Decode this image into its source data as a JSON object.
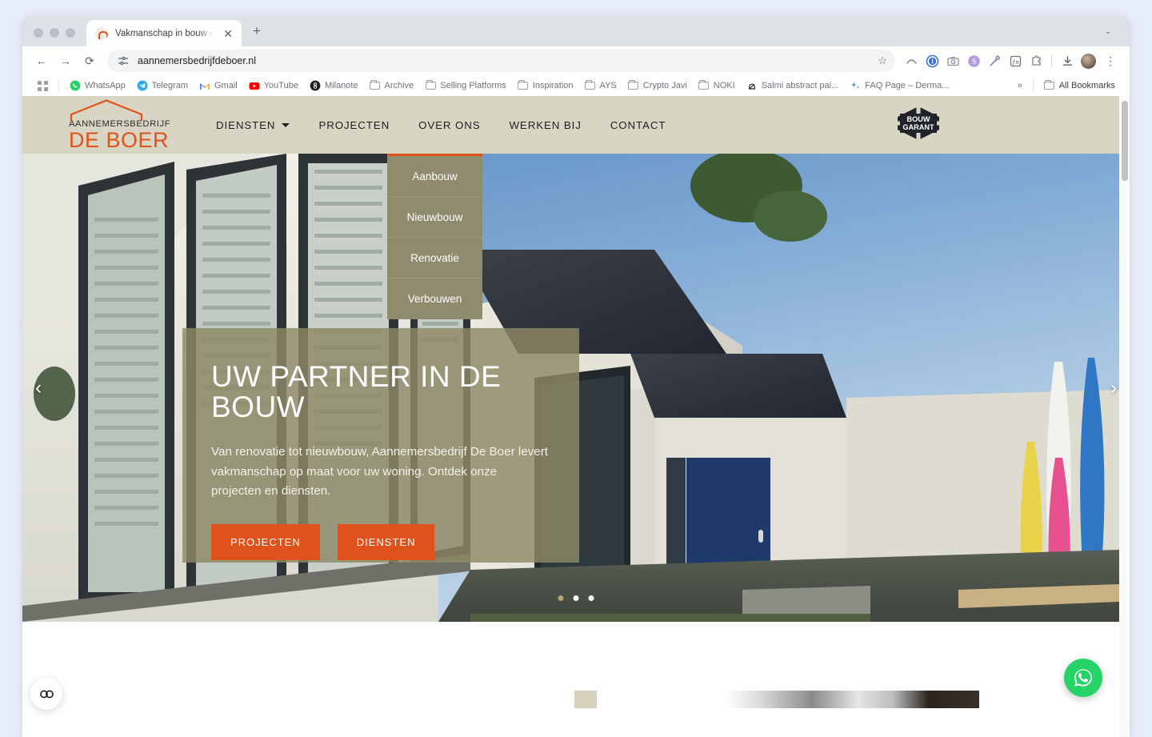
{
  "browser": {
    "tab": {
      "title": "Vakmanschap in bouw en verb",
      "close_label": "✕"
    },
    "new_tab_label": "+",
    "window_caret": "⌄",
    "nav": {
      "back": "←",
      "forward": "→",
      "reload": "⟳"
    },
    "omnibox": {
      "url": "aannemersbedrijfdeboer.nl",
      "site_info_icon": "page-settings-icon",
      "bookmark_star": "☆"
    },
    "extensions": [
      {
        "name": "arc-icon",
        "glyph": "⌃"
      },
      {
        "name": "onepassword-icon",
        "glyph": "1"
      },
      {
        "name": "screenshot-camera-icon",
        "glyph": "▣"
      },
      {
        "name": "scribe-s-icon",
        "glyph": "S"
      },
      {
        "name": "eyedropper-icon",
        "glyph": "✐"
      },
      {
        "name": "fonts-ninja-icon",
        "glyph": "ƒn"
      },
      {
        "name": "extensions-puzzle-icon",
        "glyph": "⧉"
      },
      {
        "name": "downloads-icon",
        "glyph": "⤓"
      }
    ],
    "menu_icon": "⋮",
    "bookmarks": {
      "apps_icon": "apps-grid-icon",
      "items": [
        {
          "label": "WhatsApp",
          "icon": "whatsapp-icon",
          "color": "#25D366"
        },
        {
          "label": "Telegram",
          "icon": "telegram-icon",
          "color": "#2AABEE"
        },
        {
          "label": "Gmail",
          "icon": "gmail-icon",
          "color": "#EA4335"
        },
        {
          "label": "YouTube",
          "icon": "youtube-icon",
          "color": "#FF0000"
        },
        {
          "label": "Milanote",
          "icon": "milanote-icon",
          "color": "#222222"
        },
        {
          "label": "Archive",
          "icon": "folder-icon",
          "color": ""
        },
        {
          "label": "Selling Platforms",
          "icon": "folder-icon",
          "color": ""
        },
        {
          "label": "Inspiration",
          "icon": "folder-icon",
          "color": ""
        },
        {
          "label": "AYS",
          "icon": "folder-icon",
          "color": ""
        },
        {
          "label": "Crypto Javi",
          "icon": "folder-icon",
          "color": ""
        },
        {
          "label": "NOKI",
          "icon": "folder-icon",
          "color": ""
        },
        {
          "label": "Salmi abstract pai...",
          "icon": "salmi-icon",
          "color": ""
        },
        {
          "label": "FAQ Page – Derma...",
          "icon": "sparkle-icon",
          "color": "#5B8DEF"
        }
      ],
      "overflow_label": "»",
      "all_bookmarks_label": "All Bookmarks"
    }
  },
  "site": {
    "logo": {
      "line1": "AANNEMERSBEDRIJF",
      "line2": "DE BOER"
    },
    "nav": [
      {
        "label": "DIENSTEN",
        "has_caret": true
      },
      {
        "label": "PROJECTEN",
        "has_caret": false
      },
      {
        "label": "OVER ONS",
        "has_caret": false
      },
      {
        "label": "WERKEN BIJ",
        "has_caret": false
      },
      {
        "label": "CONTACT",
        "has_caret": false
      }
    ],
    "dropdown": [
      {
        "label": "Aanbouw"
      },
      {
        "label": "Nieuwbouw"
      },
      {
        "label": "Renovatie"
      },
      {
        "label": "Verbouwen"
      }
    ],
    "badge": {
      "line1": "BOUW",
      "line2": "GARANT"
    },
    "hero": {
      "title": "UW PARTNER IN DE BOUW",
      "subtitle": "Van renovatie tot nieuwbouw, Aannemersbedrijf De Boer levert vakmanschap op maat voor uw woning. Ontdek onze projecten en diensten.",
      "primary_button": "PROJECTEN",
      "secondary_button": "DIENSTEN",
      "prev_arrow": "‹",
      "next_arrow": "›",
      "slide_count": 3,
      "active_slide": 1
    },
    "floating": {
      "accessibility_icon": "accessibility-icon",
      "whatsapp_icon": "whatsapp-icon"
    },
    "colors": {
      "header_bg": "#D9D5C5",
      "accent_orange": "#E0521C",
      "overlay_olive": "#8E8967",
      "dropdown_olive": "#8F8B6E"
    }
  }
}
